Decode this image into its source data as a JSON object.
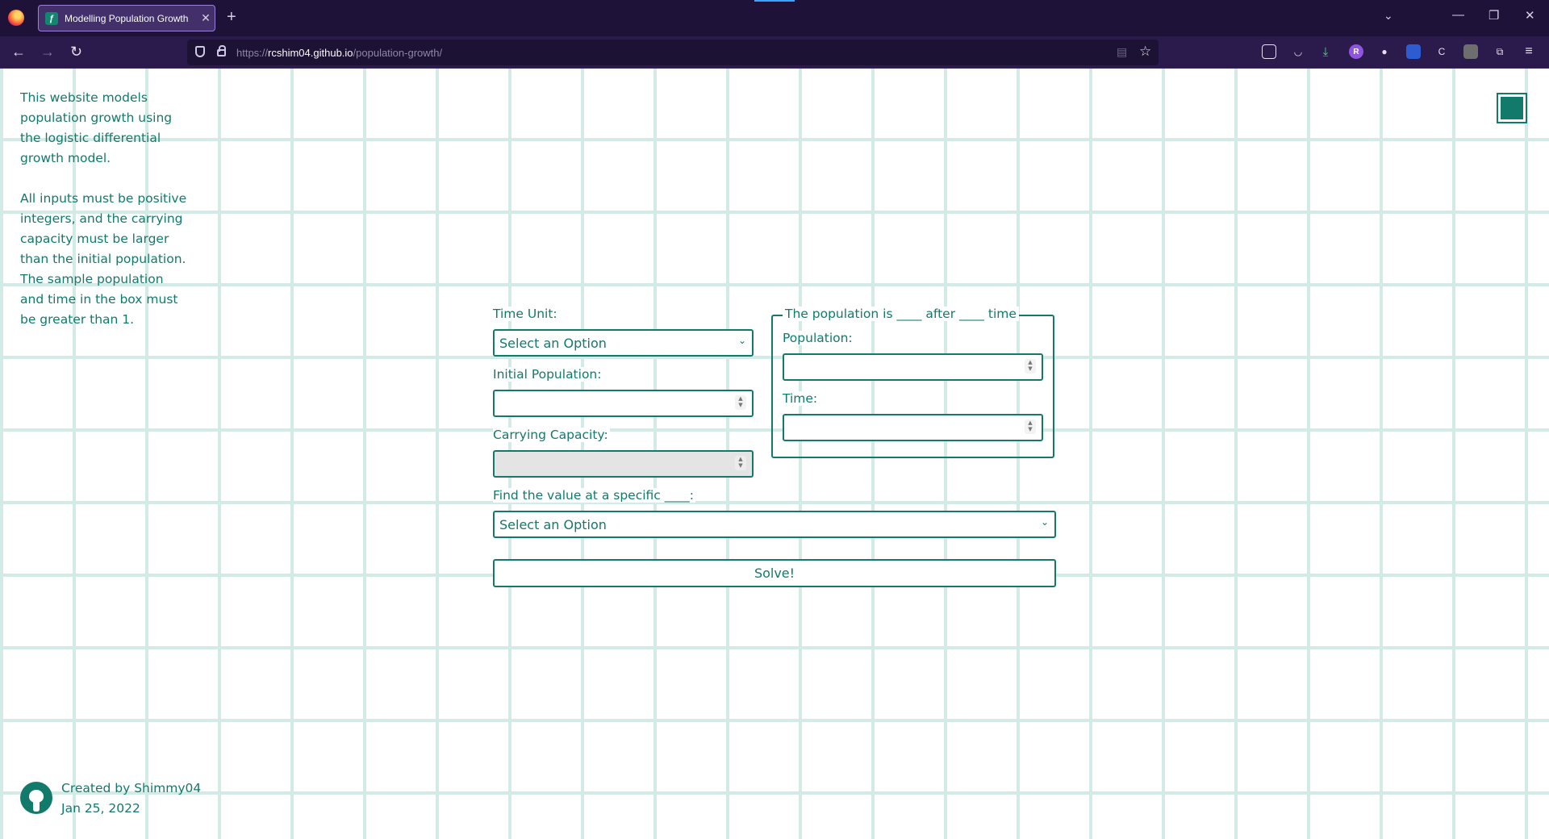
{
  "browser": {
    "tab_title": "Modelling Population Growth",
    "tab_favicon": "ƒ",
    "url_prefix": "https://",
    "url_domain": "rcshim04.github.io",
    "url_path": "/population-growth/"
  },
  "intro": {
    "paragraph1": "This website models population growth using the logistic differential growth model.",
    "paragraph2": "All inputs must be positive integers, and the carrying capacity must be larger than the initial population. The sample population and time in the box must be greater than 1."
  },
  "form": {
    "time_unit_label": "Time Unit:",
    "time_unit_value": "Select an Option",
    "initial_population_label": "Initial Population:",
    "initial_population_value": "",
    "carrying_capacity_label": "Carrying Capacity:",
    "carrying_capacity_value": "",
    "sample_legend": "The population is ____ after ____ time",
    "sample_population_label": "Population:",
    "sample_population_value": "",
    "sample_time_label": "Time:",
    "sample_time_value": "",
    "find_label": "Find the value at a specific ____:",
    "find_value": "Select an Option",
    "solve_label": "Solve!"
  },
  "footer": {
    "created_by": "Created by Shimmy04",
    "date": "Jan 25, 2022"
  },
  "colors": {
    "accent": "#117a6b",
    "grid": "#d2ebe6",
    "browser_bg": "#1f1238"
  }
}
